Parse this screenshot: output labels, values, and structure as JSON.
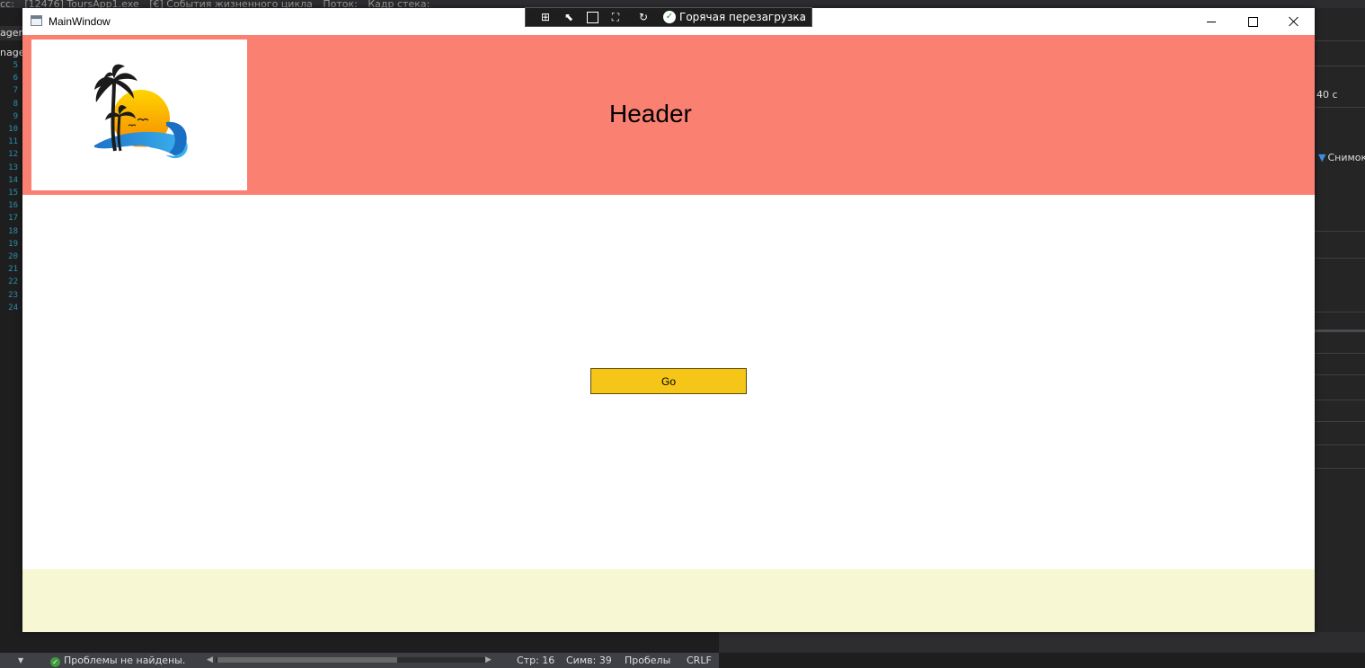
{
  "ide": {
    "top_bar": {
      "process_label": "cc:",
      "process_value": "[12476] ToursApp1.exe",
      "lifecycle_events": "[€] События жизненного цикла",
      "thread_label": "Поток:",
      "stack_frame_label": "Кадр стека:"
    },
    "left_tabs": [
      "ager",
      "nage"
    ],
    "line_numbers": [
      "5",
      "6",
      "7",
      "8",
      "9",
      "10",
      "11",
      "12",
      "13",
      "14",
      "15",
      "16",
      "17",
      "18",
      "19",
      "20",
      "21",
      "22",
      "23",
      "24"
    ],
    "right_panel": {
      "ruler_label": "40 с",
      "snapshot_label": "Снимок"
    },
    "status_bar": {
      "problems_text": "Проблемы не найдены.",
      "line": "Стр: 16",
      "column": "Симв: 39",
      "spacing": "Пробелы",
      "line_ending": "CRLF"
    }
  },
  "window": {
    "title": "MainWindow",
    "icon": "window-app-icon",
    "controls": [
      "minimize-icon",
      "maximize-icon",
      "close-icon"
    ]
  },
  "debug_toolbar": {
    "icons": [
      "live-visual-tree-icon",
      "select-element-icon",
      "display-layout-adorners-icon",
      "track-focus-icon",
      "hot-reload-icon"
    ],
    "hot_reload_label": "Горячая перезагрузка",
    "status_icon": "check-circle-icon"
  },
  "app": {
    "header": {
      "title": "Header",
      "logo": "palm-tree-sunset-logo"
    },
    "go_button_label": "Go",
    "colors": {
      "header_background": "#fa8072",
      "footer_background": "#f7f8d3",
      "button_background": "#f5c518"
    }
  }
}
